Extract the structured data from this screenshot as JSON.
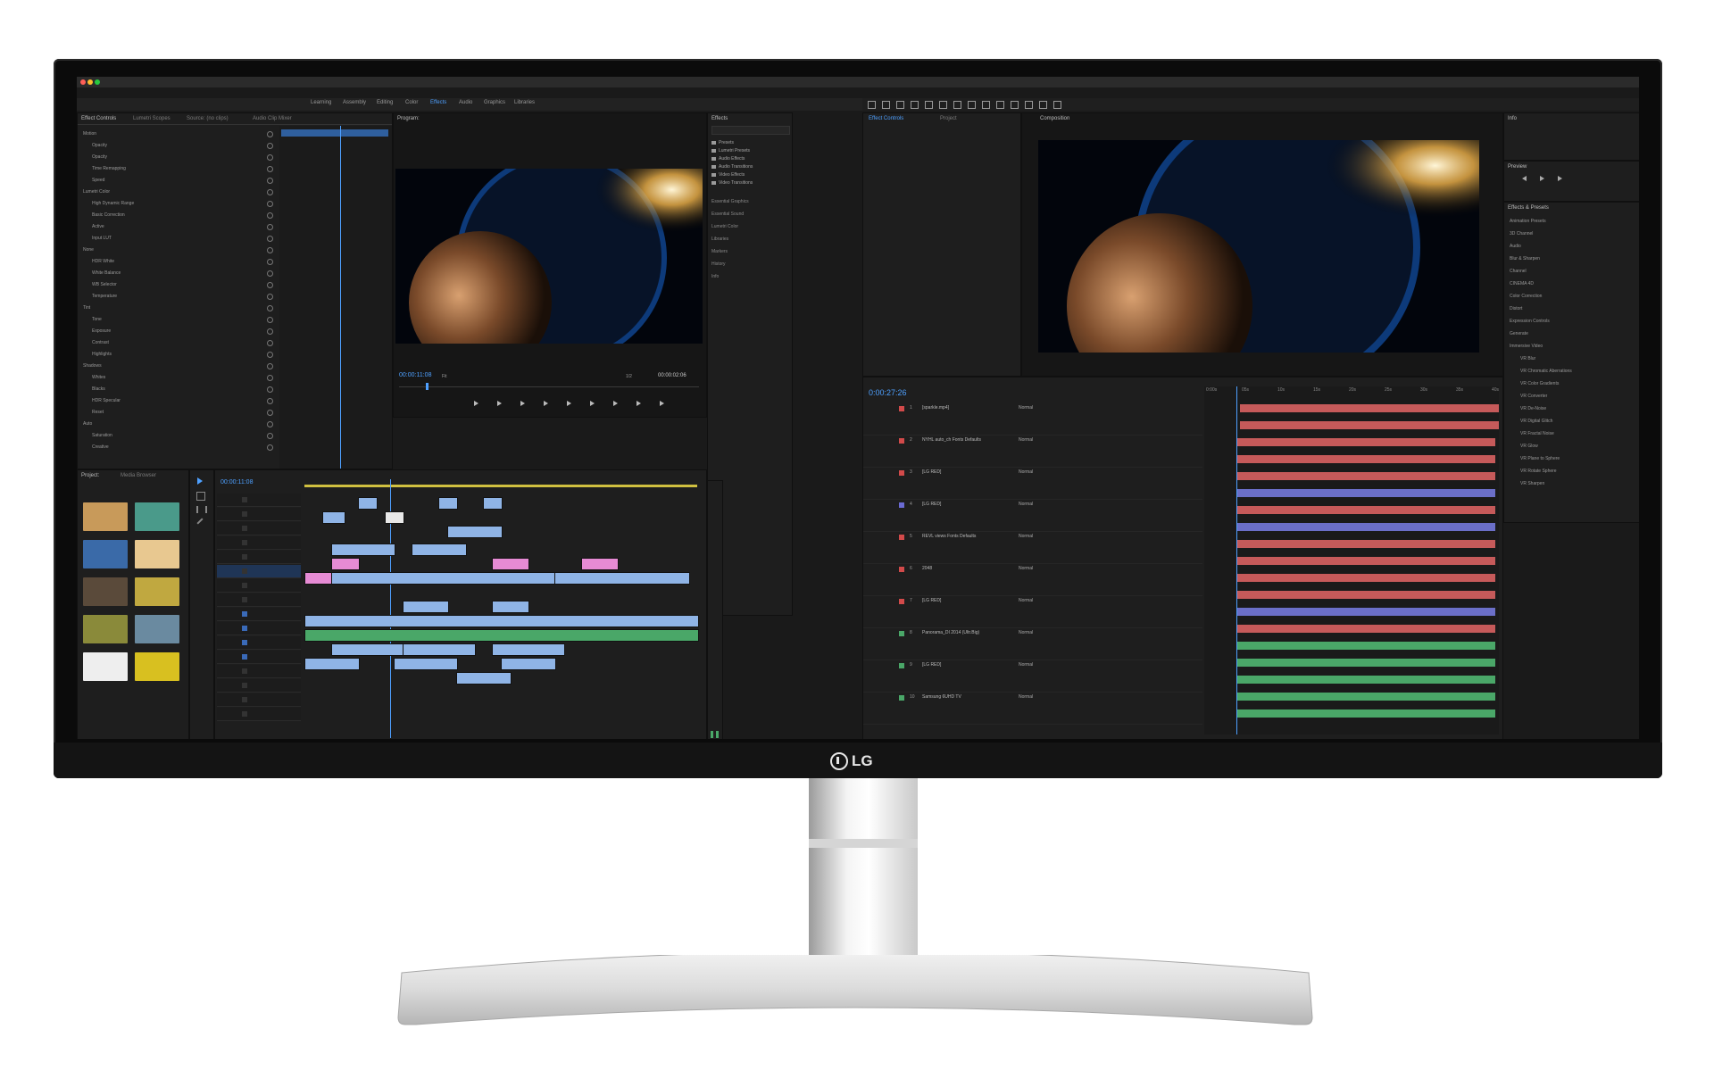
{
  "monitor": {
    "brand": "LG"
  },
  "premiere": {
    "workspaces": [
      "Learning",
      "Assembly",
      "Editing",
      "Color",
      "Effects",
      "Audio",
      "Graphics",
      "Libraries"
    ],
    "active_workspace": "Effects",
    "effect_controls_tab": "Effect Controls",
    "other_tabs": [
      "Lumetri Scopes",
      "Source: (no clips)",
      "Audio Clip Mixer"
    ],
    "effects_list": [
      "Motion",
      "Opacity",
      "Opacity",
      "Time Remapping",
      "Speed",
      "Lumetri Color",
      "High Dynamic Range",
      "Basic Correction",
      "Active",
      "Input LUT",
      "None",
      "HDR White",
      "White Balance",
      "WB Selector",
      "Temperature",
      "Tint",
      "Tone",
      "Exposure",
      "Contrast",
      "Highlights",
      "Shadows",
      "Whites",
      "Blacks",
      "HDR Specular",
      "Reset",
      "Auto",
      "Saturation",
      "Creative"
    ],
    "program_label": "Program:",
    "program_tc_left": "00:00:11:08",
    "program_tc_right": "00:00:02:06",
    "effects_panel_title": "Effects",
    "effects_items": [
      "Presets",
      "Lumetri Presets",
      "Audio Effects",
      "Audio Transitions",
      "Video Effects",
      "Video Transitions"
    ],
    "side_panels": [
      "Essential Graphics",
      "Essential Sound",
      "Lumetri Color",
      "Libraries",
      "Markers",
      "History",
      "Info"
    ],
    "project_tab": "Project:",
    "media_browser_tab": "Media Browser",
    "timeline_tc": "00:00:11:08",
    "fit_label": "Fit",
    "zoom_label": "1/2"
  },
  "aftereffects": {
    "tabs": [
      "Effect Controls",
      "Project"
    ],
    "composition_tab": "Composition",
    "comp_timecode": "0:00:27:26",
    "info_panel": "Info",
    "preview_panel": "Preview",
    "effects_presets_panel": "Effects & Presets",
    "effects_presets_items": [
      "Animation Presets",
      "3D Channel",
      "Audio",
      "Blur & Sharpen",
      "Channel",
      "CINEMA 4D",
      "Color Correction",
      "Distort",
      "Expression Controls",
      "Generate",
      "Immersive Video",
      "VR Blur",
      "VR Chromatic Aberrations",
      "VR Color Gradients",
      "VR Converter",
      "VR De-Noise",
      "VR Digital Glitch",
      "VR Fractal Noise",
      "VR Glow",
      "VR Plane to Sphere",
      "VR Rotate Sphere",
      "VR Sharpen"
    ],
    "layer_rows": [
      {
        "num": "1",
        "name": "[sparkle.mp4]",
        "mode": "Normal",
        "color": "#d24a4a"
      },
      {
        "num": "2",
        "name": "NYHL auto_ch Fonts Defaults",
        "mode": "Normal",
        "color": "#d24a4a"
      },
      {
        "num": "3",
        "name": "[LG RED]",
        "mode": "Normal",
        "color": "#d24a4a"
      },
      {
        "num": "4",
        "name": "[LG RED]",
        "mode": "Normal",
        "color": "#6a6ad2"
      },
      {
        "num": "5",
        "name": "REVL views Fonts Defaults",
        "mode": "Normal",
        "color": "#d24a4a"
      },
      {
        "num": "6",
        "name": "2048",
        "mode": "Normal",
        "color": "#d24a4a"
      },
      {
        "num": "7",
        "name": "[LG RED]",
        "mode": "Normal",
        "color": "#d24a4a"
      },
      {
        "num": "8",
        "name": "Panorama_DI 2014 (Ultr.Big)",
        "mode": "Normal",
        "color": "#4aa768"
      },
      {
        "num": "9",
        "name": "[LG RED]",
        "mode": "Normal",
        "color": "#4aa768"
      },
      {
        "num": "10",
        "name": "Samsung 6UHD TV",
        "mode": "Normal",
        "color": "#4aa768"
      }
    ],
    "timeline_bars": [
      {
        "color": "#c65a5a"
      },
      {
        "color": "#c65a5a"
      },
      {
        "color": "#c65a5a"
      },
      {
        "color": "#c65a5a"
      },
      {
        "color": "#c65a5a"
      },
      {
        "color": "#6b6fc8"
      },
      {
        "color": "#c65a5a"
      },
      {
        "color": "#6b6fc8"
      },
      {
        "color": "#c65a5a"
      },
      {
        "color": "#c65a5a"
      },
      {
        "color": "#c65a5a"
      },
      {
        "color": "#c65a5a"
      },
      {
        "color": "#6b6fc8"
      },
      {
        "color": "#c65a5a"
      },
      {
        "color": "#4aa768"
      },
      {
        "color": "#4aa768"
      },
      {
        "color": "#4aa768"
      },
      {
        "color": "#4aa768"
      },
      {
        "color": "#4aa768"
      }
    ],
    "time_ruler": [
      "0:00s",
      "05s",
      "10s",
      "15s",
      "20s",
      "25s",
      "30s",
      "35s",
      "40s"
    ]
  },
  "colors": {
    "accent_blue": "#4ea0ff",
    "brand_gray": "#e8e8e8"
  }
}
